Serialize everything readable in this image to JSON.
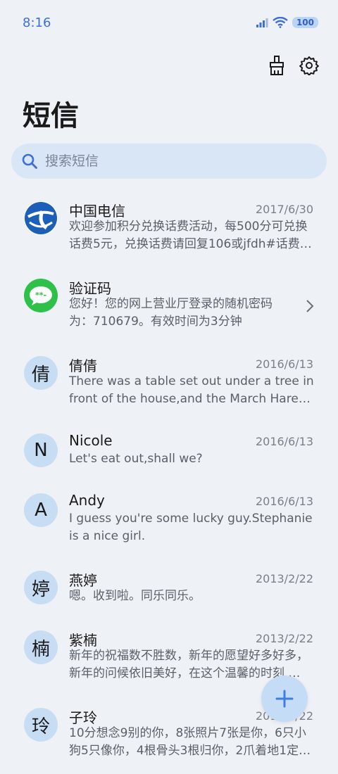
{
  "status": {
    "time": "8:16",
    "battery": "100"
  },
  "header": {
    "title": "短信",
    "clean_icon": "broom-icon",
    "settings_icon": "gear-icon"
  },
  "search": {
    "placeholder": "搜索短信"
  },
  "messages": [
    {
      "sender": "中国电信",
      "date": "2017/6/30",
      "avatar": "china-telecom-logo",
      "preview": "欢迎参加积分兑换话费活动，每500分可兑换话费5元，兑换话费请回复106或jfdh#话费…"
    },
    {
      "sender": "验证码",
      "date": "",
      "avatar": "chat-bubble-icon",
      "preview": "您好！您的网上营业厅登录的随机密码为：710679。有效时间为3分钟"
    },
    {
      "sender": "倩倩",
      "date": "2016/6/13",
      "avatar": "倩",
      "preview": "There was a table set out under a tree in front of the house,and the March Hare an…"
    },
    {
      "sender": "Nicole",
      "date": "2016/6/13",
      "avatar": "N",
      "preview": "Let's eat out,shall we?"
    },
    {
      "sender": "Andy",
      "date": "2016/6/13",
      "avatar": "A",
      "preview": "I guess you're some lucky guy.Stephanie is a nice girl."
    },
    {
      "sender": "燕婷",
      "date": "2013/2/22",
      "avatar": "婷",
      "preview": "嗯。收到啦。同乐同乐。"
    },
    {
      "sender": "紫楠",
      "date": "2013/2/22",
      "avatar": "楠",
      "preview": "新年的祝福数不胜数，新年的愿望好多好多，新年的问候依旧美好，在这个温馨的时刻 …"
    },
    {
      "sender": "子玲",
      "date": "2013/2/22",
      "avatar": "玲",
      "preview": "10分想念9别的你，8张照片7张是你，6只小狗5只像你，4根骨头3根归你，2爪着地1定…"
    }
  ],
  "fab": {
    "icon": "plus-icon"
  }
}
